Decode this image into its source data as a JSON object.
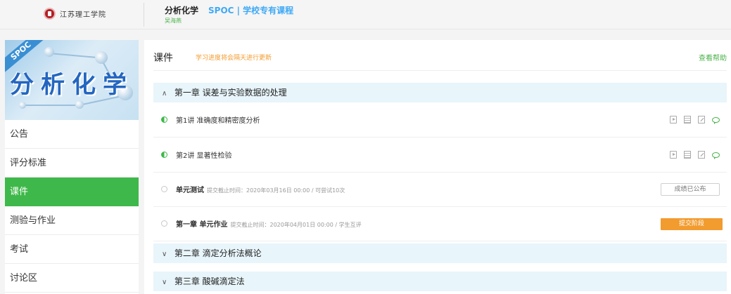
{
  "header": {
    "school_logo_text": "江苏理工学院",
    "course_title": "分析化学",
    "course_tag": "SPOC | 学校专有课程",
    "teacher": "吴海燕"
  },
  "sidebar": {
    "cover_badge": "SPOC",
    "cover_title": "分析化学",
    "items": [
      {
        "label": "公告",
        "active": false
      },
      {
        "label": "评分标准",
        "active": false
      },
      {
        "label": "课件",
        "active": true
      },
      {
        "label": "测验与作业",
        "active": false
      },
      {
        "label": "考试",
        "active": false
      },
      {
        "label": "讨论区",
        "active": false
      }
    ]
  },
  "main": {
    "heading": "课件",
    "note": "学习进度将会隔天进行更新",
    "help": "查看帮助",
    "chapters": [
      {
        "title": "第一章 误差与实验数据的处理",
        "expanded": true,
        "items": [
          {
            "kind": "lesson",
            "title": "第1讲 准确度和精密度分析",
            "icons": [
              "video-icon",
              "document-icon",
              "edit-icon",
              "discussion-icon"
            ]
          },
          {
            "kind": "lesson",
            "title": "第2讲 显著性检验",
            "icons": [
              "video-icon",
              "document-icon",
              "edit-icon",
              "discussion-icon"
            ]
          },
          {
            "kind": "test",
            "title": "单元测试",
            "meta": "提交截止时间：2020年03月16日 00:00 / 可尝试10次",
            "button": "成绩已公布"
          },
          {
            "kind": "homework",
            "title": "第一章 单元作业",
            "meta": "提交截止时间：2020年04月01日 00:00 / 学生互评",
            "button": "提交阶段"
          }
        ]
      },
      {
        "title": "第二章 滴定分析法概论",
        "expanded": false
      },
      {
        "title": "第三章 酸碱滴定法",
        "expanded": false
      }
    ]
  },
  "colors": {
    "accent_green": "#3eb84a",
    "tag_blue": "#3fa9f5",
    "note_orange": "#f29b2e",
    "chapter_bg": "#e8f5fb"
  }
}
